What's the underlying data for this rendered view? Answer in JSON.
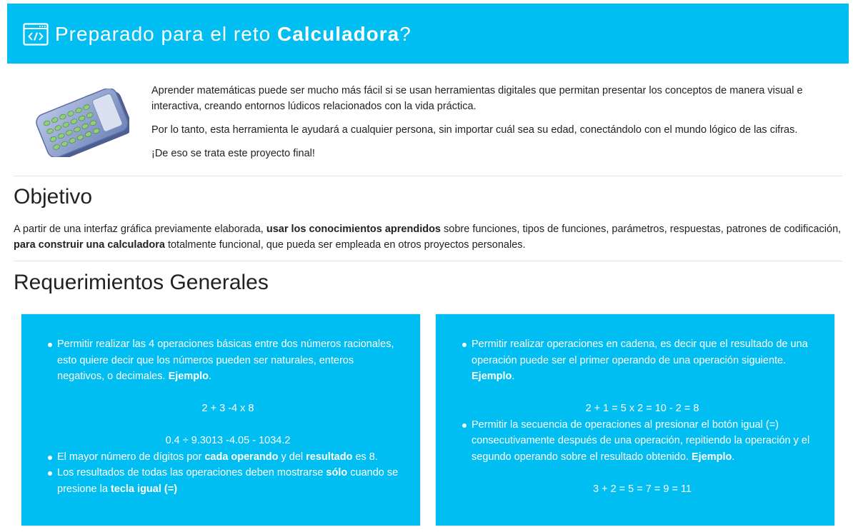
{
  "header": {
    "title_prefix": "Preparado para el reto ",
    "title_bold": "Calculadora",
    "title_suffix": "?",
    "icon": "code-window-icon"
  },
  "intro": {
    "image": "calculator-illustration",
    "paragraph1": "Aprender matemáticas puede ser mucho más fácil si se usan herramientas digitales que permitan presentar los conceptos de manera visual e interactiva, creando entornos lúdicos relacionados con la vida práctica.",
    "paragraph2": "Por lo tanto, esta herramienta le ayudará a cualquier persona, sin importar cuál sea su edad, conectándolo con el mundo lógico de las cifras.",
    "paragraph3": "¡De eso se trata este proyecto final!"
  },
  "objetivo": {
    "title": "Objetivo",
    "text_1": "A partir de una interfaz gráfica previamente elaborada, ",
    "bold_1": "usar los conocimientos aprendidos",
    "text_2": " sobre funciones, tipos de funciones, parámetros, respuestas, patrones de codificación, ",
    "bold_2": "para construir una calculadora",
    "text_3": " totalmente funcional, que pueda ser empleada en otros proyectos personales."
  },
  "requerimientos": {
    "title": "Requerimientos Generales",
    "left": {
      "item1_text": "Permitir realizar las 4 operaciones básicas entre dos números racionales, esto quiere decir que los números pueden ser naturales, enteros negativos, o decimales. ",
      "item1_bold": "Ejemplo",
      "item1_end": ".",
      "example1": "2 + 3 -4 x 8",
      "example2": "0.4 ÷ 9.3013 -4.05 - 1034.2",
      "item2_text": "El mayor número de dígitos por ",
      "item2_bold1": "cada operando",
      "item2_mid": " y del ",
      "item2_bold2": "resultado",
      "item2_end": " es 8.",
      "item3_text": "Los resultados de todas las operaciones deben mostrarse ",
      "item3_bold1": "sólo",
      "item3_mid": " cuando se presione la ",
      "item3_bold2": "tecla igual (=)"
    },
    "right": {
      "item1_text": "Permitir realizar operaciones en cadena, es decir que el resultado de una operación puede ser el primer operando de una operación siguiente. ",
      "item1_bold": "Ejemplo",
      "item1_end": ".",
      "example1": "2 + 1 = 5 x 2 = 10 - 2 = 8",
      "item2_text": "Permitir la secuencia de operaciones al presionar el botón igual (=) consecutivamente después de una operación, repitiendo la operación y el segundo operando sobre el resultado obtenido. ",
      "item2_bold": "Ejemplo",
      "item2_end": ".",
      "example2": "3 + 2 = 5 = 7 = 9 = 11"
    }
  },
  "colors": {
    "accent": "#00bdf2",
    "text": "#222222",
    "divider": "#e2e2e2"
  }
}
